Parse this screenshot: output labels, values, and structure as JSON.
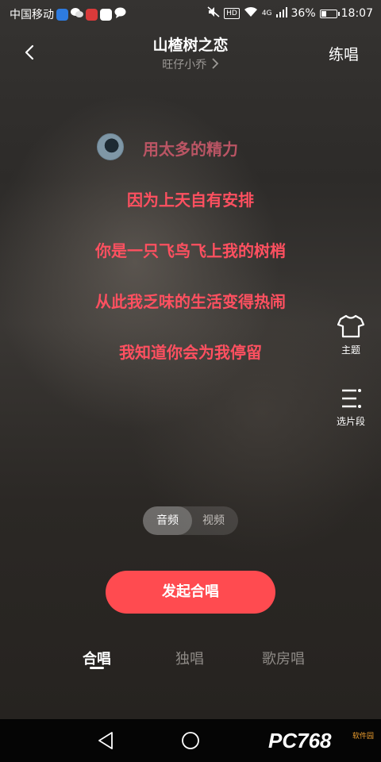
{
  "status_bar": {
    "carrier": "中国移动",
    "network": "4G",
    "hd": "HD",
    "battery": "36%",
    "battery_level": 0.36,
    "time": "18:07"
  },
  "header": {
    "title": "山楂树之恋",
    "subtitle": "旺仔小乔",
    "practice_label": "练唱"
  },
  "lyrics": [
    "用太多的精力",
    "因为上天自有安排",
    "你是一只飞鸟飞上我的树梢",
    "从此我乏味的生活变得热闹",
    "我知道你会为我停留"
  ],
  "side_actions": {
    "theme_label": "主题",
    "segment_label": "选片段"
  },
  "media_toggle": {
    "options": [
      "音频",
      "视频"
    ],
    "selected": "音频"
  },
  "cta": {
    "label": "发起合唱"
  },
  "tabs": [
    {
      "label": "合唱",
      "active": true
    },
    {
      "label": "独唱",
      "active": false
    },
    {
      "label": "歌房唱",
      "active": false
    }
  ],
  "watermark": {
    "text": "PC768",
    "sub": "软件园"
  },
  "colors": {
    "lyric": "#ff5060",
    "cta": "#ff4b50",
    "background": "#2d2b29"
  }
}
